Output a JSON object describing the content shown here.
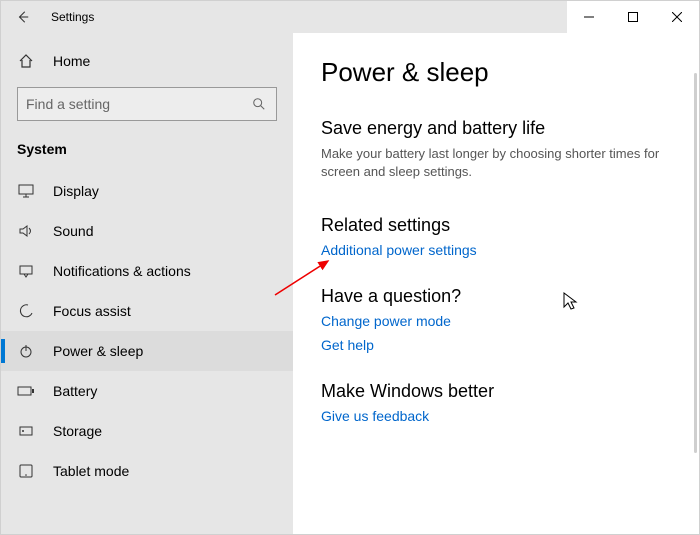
{
  "window": {
    "title": "Settings"
  },
  "sidebar": {
    "home_label": "Home",
    "search_placeholder": "Find a setting",
    "category_label": "System",
    "items": [
      {
        "icon": "display",
        "label": "Display"
      },
      {
        "icon": "sound",
        "label": "Sound"
      },
      {
        "icon": "notifications",
        "label": "Notifications & actions"
      },
      {
        "icon": "focus",
        "label": "Focus assist"
      },
      {
        "icon": "power",
        "label": "Power & sleep"
      },
      {
        "icon": "battery",
        "label": "Battery"
      },
      {
        "icon": "storage",
        "label": "Storage"
      },
      {
        "icon": "tablet",
        "label": "Tablet mode"
      }
    ]
  },
  "main": {
    "title": "Power & sleep",
    "energy": {
      "heading": "Save energy and battery life",
      "body": "Make your battery last longer by choosing shorter times for screen and sleep settings."
    },
    "related": {
      "heading": "Related settings",
      "link": "Additional power settings"
    },
    "question": {
      "heading": "Have a question?",
      "link1": "Change power mode",
      "link2": "Get help"
    },
    "feedback": {
      "heading": "Make Windows better",
      "link": "Give us feedback"
    }
  }
}
